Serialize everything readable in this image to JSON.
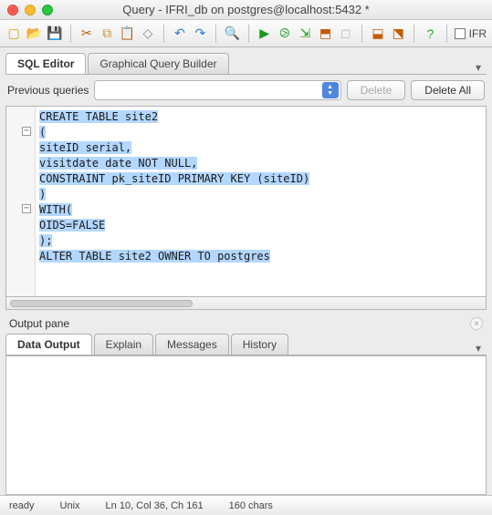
{
  "window": {
    "title": "Query - IFRI_db on postgres@localhost:5432 *",
    "right_tab_label": "IFR"
  },
  "toolbar": {
    "icons": {
      "new": "new-file-icon",
      "open": "open-icon",
      "save": "save-icon",
      "cut": "cut-icon",
      "copy": "copy-icon",
      "paste": "paste-icon",
      "clear": "clear-icon",
      "undo": "undo-icon",
      "redo": "redo-icon",
      "find": "find-icon",
      "run": "run-icon",
      "run_pg": "run-pgscript-icon",
      "explain": "explain-icon",
      "explain_analyze": "explain-analyze-icon",
      "cancel": "cancel-query-icon",
      "fav": "favorites-icon",
      "history": "history-icon",
      "help": "help-icon"
    }
  },
  "tabs": {
    "sql_editor": "SQL Editor",
    "gqb": "Graphical Query Builder"
  },
  "prev": {
    "label": "Previous queries",
    "delete": "Delete",
    "delete_all": "Delete All"
  },
  "editor": {
    "lines": [
      "CREATE TABLE site2",
      "(",
      "siteID serial,",
      "visitdate date NOT NULL,",
      "CONSTRAINT pk_siteID PRIMARY KEY (siteID)",
      ")",
      "WITH(",
      "OIDS=FALSE",
      ");",
      "ALTER TABLE site2 OWNER TO postgres"
    ]
  },
  "output": {
    "pane_label": "Output pane",
    "tabs": {
      "data": "Data Output",
      "explain": "Explain",
      "messages": "Messages",
      "history": "History"
    }
  },
  "status": {
    "ready": "ready",
    "platform": "Unix",
    "pos": "Ln 10, Col 36, Ch 161",
    "chars": "160 chars"
  }
}
